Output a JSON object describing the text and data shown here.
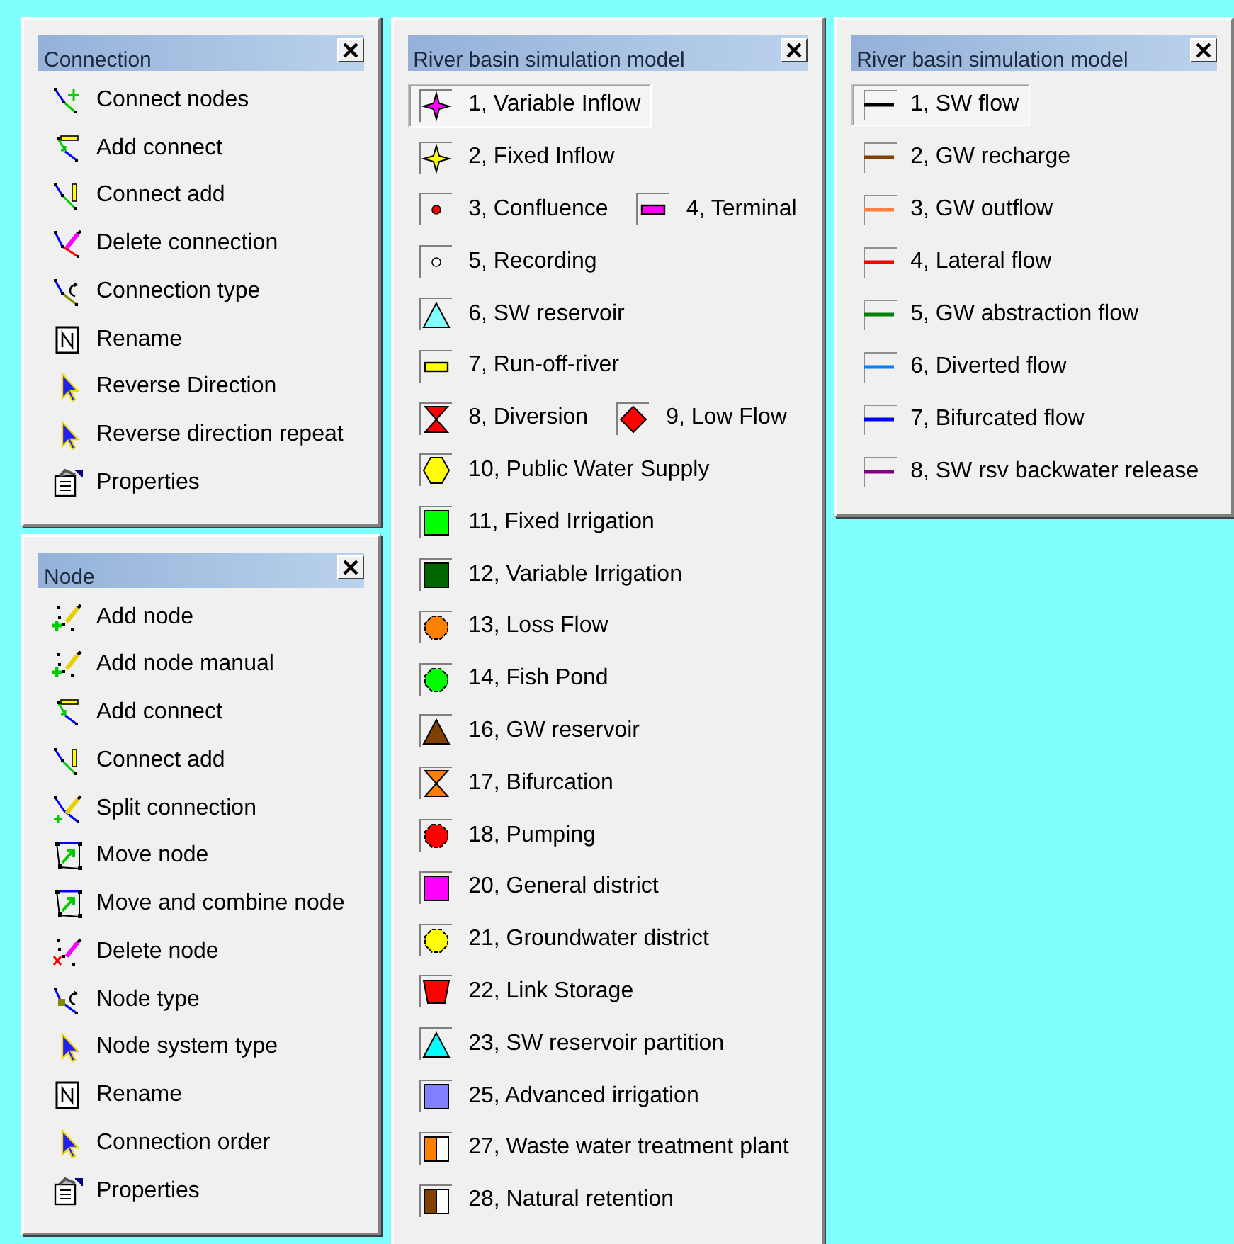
{
  "columns": [
    {
      "panels": [
        {
          "kind": "tools",
          "title": "Connection",
          "items": [
            {
              "label": "Connect nodes",
              "kind": "connect-nodes"
            },
            {
              "label": "Add connect",
              "kind": "add-connect"
            },
            {
              "label": "Connect add",
              "kind": "connect-add"
            },
            {
              "label": "Delete connection",
              "kind": "delete-connection"
            },
            {
              "label": "Connection type",
              "kind": "connection-type"
            },
            {
              "label": "Rename",
              "kind": "rename"
            },
            {
              "label": "Reverse Direction",
              "kind": "pointer"
            },
            {
              "label": "Reverse direction repeat",
              "kind": "pointer"
            },
            {
              "label": "Properties",
              "kind": "properties"
            }
          ]
        },
        {
          "kind": "tools",
          "title": "Node",
          "items": [
            {
              "label": "Add node",
              "kind": "add-node"
            },
            {
              "label": "Add node manual",
              "kind": "add-node"
            },
            {
              "label": "Add connect",
              "kind": "add-connect"
            },
            {
              "label": "Connect add",
              "kind": "connect-add"
            },
            {
              "label": "Split connection",
              "kind": "split-connection"
            },
            {
              "label": "Move node",
              "kind": "move-node"
            },
            {
              "label": "Move and combine node",
              "kind": "move-node"
            },
            {
              "label": "Delete node",
              "kind": "delete-node"
            },
            {
              "label": "Node type",
              "kind": "node-type"
            },
            {
              "label": "Node system type",
              "kind": "pointer"
            },
            {
              "label": "Rename",
              "kind": "rename"
            },
            {
              "label": "Connection order",
              "kind": "pointer"
            },
            {
              "label": "Properties",
              "kind": "properties"
            }
          ]
        }
      ]
    },
    {
      "panels": [
        {
          "kind": "symbols",
          "title": "River basin simulation model",
          "rows": [
            {
              "items": [
                {
                  "label": "1, Variable Inflow",
                  "kind": "star",
                  "color": "#ff00ff",
                  "selected": true
                }
              ]
            },
            {
              "items": [
                {
                  "label": "2, Fixed Inflow",
                  "kind": "star",
                  "color": "#ffff00",
                  "selected": false
                }
              ]
            },
            {
              "items": [
                {
                  "label": "3, Confluence",
                  "kind": "dot",
                  "color": "#ff0000",
                  "selected": false
                },
                {
                  "label": "4, Terminal",
                  "kind": "bar",
                  "color": "#ff00ff",
                  "selected": false
                }
              ]
            },
            {
              "items": [
                {
                  "label": "5, Recording",
                  "kind": "dot",
                  "color": "#ffffff",
                  "selected": false
                }
              ]
            },
            {
              "items": [
                {
                  "label": "6, SW reservoir",
                  "kind": "triangle",
                  "color": "#80ffff",
                  "selected": false
                }
              ]
            },
            {
              "items": [
                {
                  "label": "7, Run-off-river",
                  "kind": "bar",
                  "color": "#ffff00",
                  "selected": false
                }
              ]
            },
            {
              "items": [
                {
                  "label": "8, Diversion",
                  "kind": "hourglass",
                  "color": "#ff0000",
                  "selected": false
                },
                {
                  "label": "9, Low Flow",
                  "kind": "diamond",
                  "color": "#ff0000",
                  "selected": false
                }
              ]
            },
            {
              "items": [
                {
                  "label": "10, Public Water Supply",
                  "kind": "hexagon",
                  "color": "#ffff00",
                  "selected": false
                }
              ]
            },
            {
              "items": [
                {
                  "label": "11, Fixed Irrigation",
                  "kind": "square",
                  "color": "#00ff00",
                  "selected": false
                }
              ]
            },
            {
              "items": [
                {
                  "label": "12, Variable Irrigation",
                  "kind": "square",
                  "color": "#006400",
                  "selected": false
                }
              ]
            },
            {
              "items": [
                {
                  "label": "13, Loss Flow",
                  "kind": "octagon",
                  "color": "#ff8000",
                  "selected": false
                }
              ]
            },
            {
              "items": [
                {
                  "label": "14, Fish Pond",
                  "kind": "octagon",
                  "color": "#00ff00",
                  "selected": false
                }
              ]
            },
            {
              "items": [
                {
                  "label": "16, GW reservoir",
                  "kind": "triangle",
                  "color": "#804000",
                  "selected": false
                }
              ]
            },
            {
              "items": [
                {
                  "label": "17, Bifurcation",
                  "kind": "hourglass",
                  "color": "#ff8000",
                  "selected": false
                }
              ]
            },
            {
              "items": [
                {
                  "label": "18, Pumping",
                  "kind": "octagon",
                  "color": "#ff0000",
                  "selected": false
                }
              ]
            },
            {
              "items": [
                {
                  "label": "20, General district",
                  "kind": "square",
                  "color": "#ff00ff",
                  "selected": false
                }
              ]
            },
            {
              "items": [
                {
                  "label": "21, Groundwater district",
                  "kind": "octagon",
                  "color": "#ffff00",
                  "selected": false
                }
              ]
            },
            {
              "items": [
                {
                  "label": "22, Link Storage",
                  "kind": "trapezoid",
                  "color": "#ff0000",
                  "selected": false
                }
              ]
            },
            {
              "items": [
                {
                  "label": "23, SW reservoir partition",
                  "kind": "triangle",
                  "color": "#00ffff",
                  "selected": false
                }
              ]
            },
            {
              "items": [
                {
                  "label": "25, Advanced irrigation",
                  "kind": "square",
                  "color": "#8080ff",
                  "selected": false
                }
              ]
            },
            {
              "items": [
                {
                  "label": "27, Waste water treatment plant",
                  "kind": "half-square",
                  "color": "#ff8000",
                  "selected": false
                }
              ]
            },
            {
              "items": [
                {
                  "label": "28, Natural retention",
                  "kind": "half-square",
                  "color": "#804000",
                  "selected": false
                }
              ]
            }
          ]
        }
      ]
    },
    {
      "panels": [
        {
          "kind": "lines",
          "title": "River basin simulation model",
          "items": [
            {
              "label": "1, SW flow",
              "color": "#000000",
              "selected": true
            },
            {
              "label": "2, GW recharge",
              "color": "#804000",
              "selected": false
            },
            {
              "label": "3, GW outflow",
              "color": "#ff8040",
              "selected": false
            },
            {
              "label": "4, Lateral flow",
              "color": "#ff0000",
              "selected": false
            },
            {
              "label": "5, GW abstraction flow",
              "color": "#008000",
              "selected": false
            },
            {
              "label": "6, Diverted flow",
              "color": "#0080ff",
              "selected": false
            },
            {
              "label": "7, Bifurcated flow",
              "color": "#0000ff",
              "selected": false
            },
            {
              "label": "8, SW rsv backwater release",
              "color": "#800080",
              "selected": false
            }
          ]
        }
      ]
    }
  ]
}
